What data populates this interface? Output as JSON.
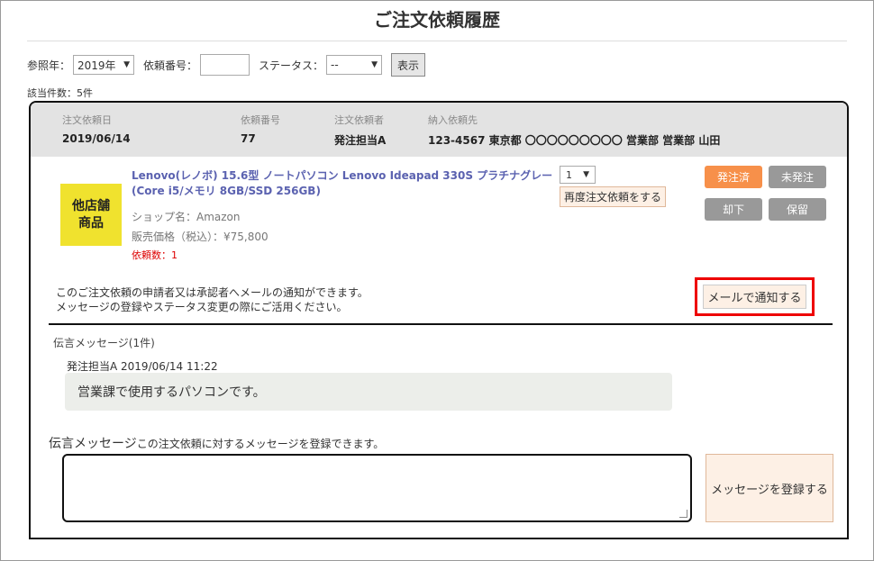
{
  "page": {
    "title": "ご注文依頼履歴"
  },
  "filters": {
    "year_label": "参照年：",
    "year_value": "2019年",
    "request_no_label": "依頼番号：",
    "request_no_value": "",
    "status_label": "ステータス：",
    "status_value": "--",
    "show_button": "表示"
  },
  "result_count": "該当件数：5件",
  "order": {
    "headers": {
      "order_date": "注文依頼日",
      "request_no": "依頼番号",
      "requester": "注文依頼者",
      "delivery": "納入依頼先"
    },
    "values": {
      "order_date": "2019/06/14",
      "request_no": "77",
      "requester": "発注担当A",
      "delivery": "123-4567 東京都 〇〇〇〇〇〇〇〇〇 営業部 営業部 山田"
    },
    "item": {
      "badge_line1": "他店舗",
      "badge_line2": "商品",
      "name": "Lenovo(レノボ) 15.6型 ノートパソコン Lenovo Ideapad 330S プラチナグレー(Core i5/メモリ 8GB/SSD 256GB)",
      "shop": "ショップ名：Amazon",
      "price": "販売価格（税込）：¥75,800",
      "quantity_text": "依頼数：1",
      "quantity_select": "1",
      "reorder_button": "再度注文依頼をする"
    },
    "status_buttons": {
      "ordered": "発注済",
      "not_ordered": "未発注",
      "rejected": "却下",
      "on_hold": "保留"
    },
    "status_colors": {
      "active": "#f7904a",
      "inactive": "#999999"
    },
    "notify": {
      "line1": "このご注文依頼の申請者又は承認者へメールの通知ができます。",
      "line2": "メッセージの登録やステータス変更の際にご活用ください。",
      "button": "メールで通知する"
    },
    "messages": {
      "heading": "伝言メッセージ(1件)",
      "list": [
        {
          "meta": "発注担当A 2019/06/14 11:22",
          "text": "営業課で使用するパソコンです。"
        }
      ]
    },
    "compose": {
      "label": "伝言メッセージ",
      "sublabel": "この注文依頼に対するメッセージを登録できます。",
      "textarea_value": "",
      "submit_button": "メッセージを登録する"
    }
  }
}
